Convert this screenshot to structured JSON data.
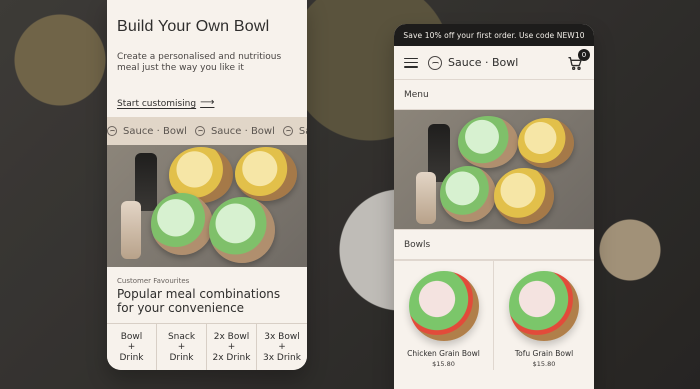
{
  "left_phone": {
    "title": "Build Your Own Bowl",
    "subtitle": "Create a personalised and nutritious meal just the way you like it",
    "cta_label": "Start customising",
    "cta_icon": "arrow-right-icon",
    "marquee_items": [
      "Sauce · Bowl",
      "Sauce · Bowl",
      "Sauce · Bowl"
    ],
    "favourites_kicker": "Customer Favourites",
    "favourites_title": "Popular meal combinations for your convenience",
    "combo_buttons": [
      "Bowl\n+\nDrink",
      "Snack\n+\nDrink",
      "2x Bowl\n+\n2x Drink",
      "3x Bowl\n+\n3x Drink"
    ]
  },
  "right_phone": {
    "promo_text": "Save 10% off your first order. Use code NEW10",
    "brand_name": "Sauce · Bowl",
    "cart_count": "0",
    "menu_label": "Menu",
    "bowls_label": "Bowls",
    "products": [
      {
        "name": "Chicken Grain Bowl",
        "price": "$15.80"
      },
      {
        "name": "Tofu Grain Bowl",
        "price": "$15.80"
      }
    ]
  },
  "icons": {
    "hamburger": "hamburger-menu-icon",
    "cart": "shopping-cart-icon",
    "logo": "sauce-bowl-logo-icon"
  }
}
